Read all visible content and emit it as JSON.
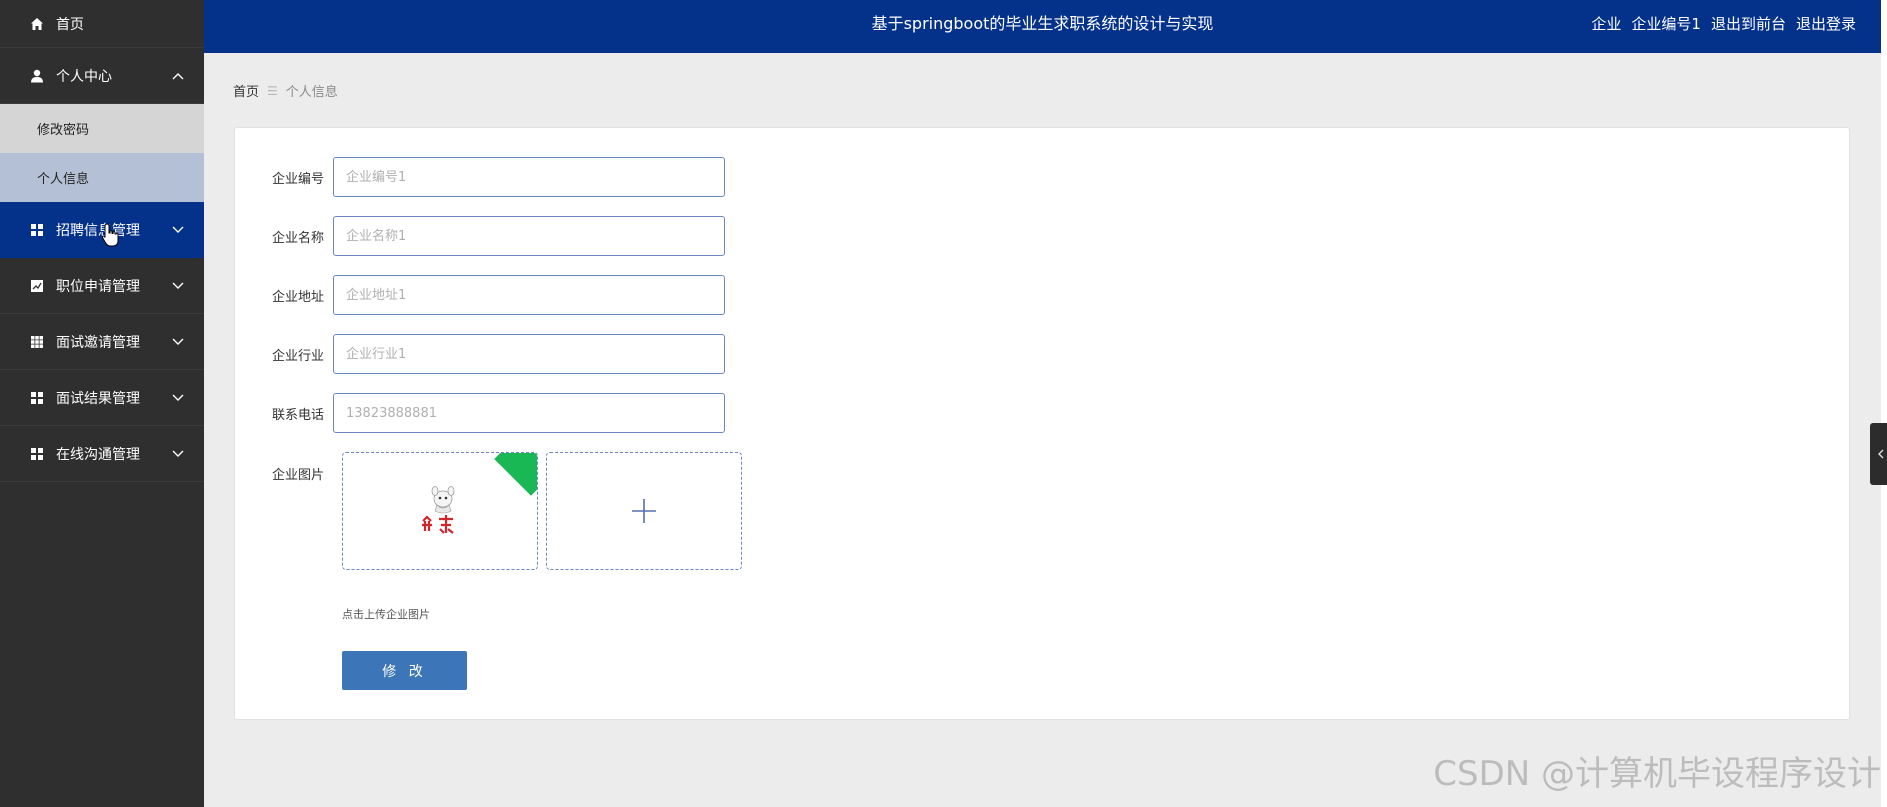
{
  "sidebar": {
    "home": "首页",
    "personal_center": "个人中心",
    "sub_items": [
      "修改密码",
      "个人信息"
    ],
    "menus": [
      "招聘信息管理",
      "职位申请管理",
      "面试邀请管理",
      "面试结果管理",
      "在线沟通管理"
    ]
  },
  "topbar": {
    "title": "基于springboot的毕业生求职系统的设计与实现",
    "role": "企业",
    "username": "企业编号1",
    "go_front": "退出到前台",
    "logout": "退出登录"
  },
  "breadcrumb": {
    "home": "首页",
    "separator": "☰",
    "current": "个人信息"
  },
  "form": {
    "fields": [
      {
        "label": "企业编号",
        "placeholder": "企业编号1"
      },
      {
        "label": "企业名称",
        "placeholder": "企业名称1"
      },
      {
        "label": "企业地址",
        "placeholder": "企业地址1"
      },
      {
        "label": "企业行业",
        "placeholder": "企业行业1"
      },
      {
        "label": "联系电话",
        "placeholder": "13823888881"
      }
    ],
    "image_label": "企业图片",
    "upload_hint": "点击上传企业图片",
    "submit_label": "修 改"
  },
  "watermark": "CSDN @计算机毕设程序设计",
  "colors": {
    "sidebar_bg": "#2f2f2f",
    "primary": "#04318a",
    "button": "#3c76b8",
    "corner": "#19b855"
  }
}
